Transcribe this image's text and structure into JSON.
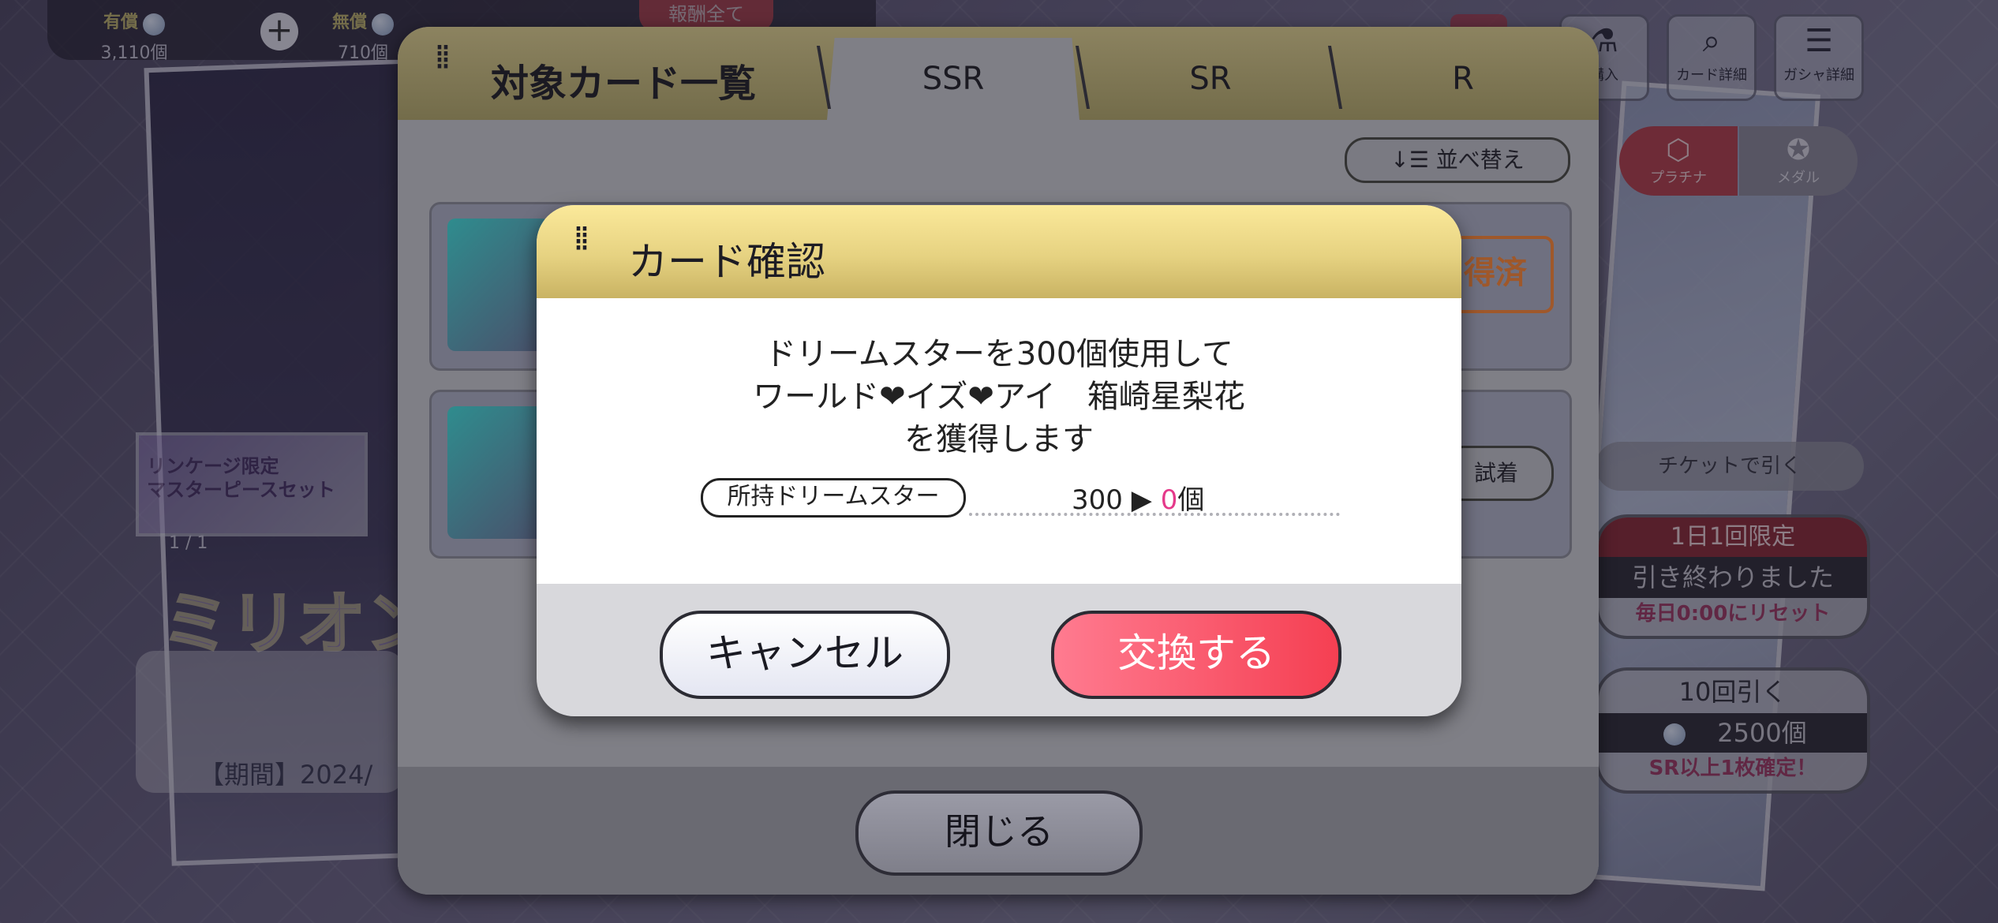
{
  "currency": {
    "paid_label": "有償",
    "paid_value": "3,110個",
    "free_label": "無償",
    "free_value": "710個",
    "reward_label": "報酬全て"
  },
  "top_right": {
    "buy_label": "購入",
    "card_detail_label": "カード詳細",
    "gacha_detail_label": "ガシャ詳細"
  },
  "segment": {
    "platinum": "プラチナ",
    "medal": "メダル"
  },
  "gacha": {
    "ticket_label": "チケットで引く",
    "daily_header": "1日1回限定",
    "daily_status": "引き終わりました",
    "daily_reset": "毎日0:00にリセット",
    "ten_label": "10回引く",
    "ten_cost": "2500個",
    "ten_guarantee": "SR以上1枚確定！"
  },
  "banner": {
    "title_line1": "リンケージ限定",
    "title_line2": "マスターピースセット",
    "count": "1 / 1",
    "logo_text": "ミリオン",
    "period": "【期間】2024/"
  },
  "list_panel": {
    "title": "対象カード一覧",
    "tabs": [
      "SSR",
      "SR",
      "R"
    ],
    "sort_label": "並べ替え",
    "owned_badge": "得済",
    "try_on_label": "試着",
    "close_label": "閉じる"
  },
  "modal": {
    "title": "カード確認",
    "message_line1": "ドリームスターを300個使用して",
    "message_line2": "ワールド❤イズ❤アイ　箱崎星梨花",
    "message_line3": "を獲得します",
    "owned_label": "所持ドリームスター",
    "owned_before": "300",
    "arrow": "▶",
    "owned_after": "0",
    "unit": "個",
    "cancel_label": "キャンセル",
    "confirm_label": "交換する",
    "accent_color": "#f53f52",
    "highlight_color": "#e5398a"
  }
}
